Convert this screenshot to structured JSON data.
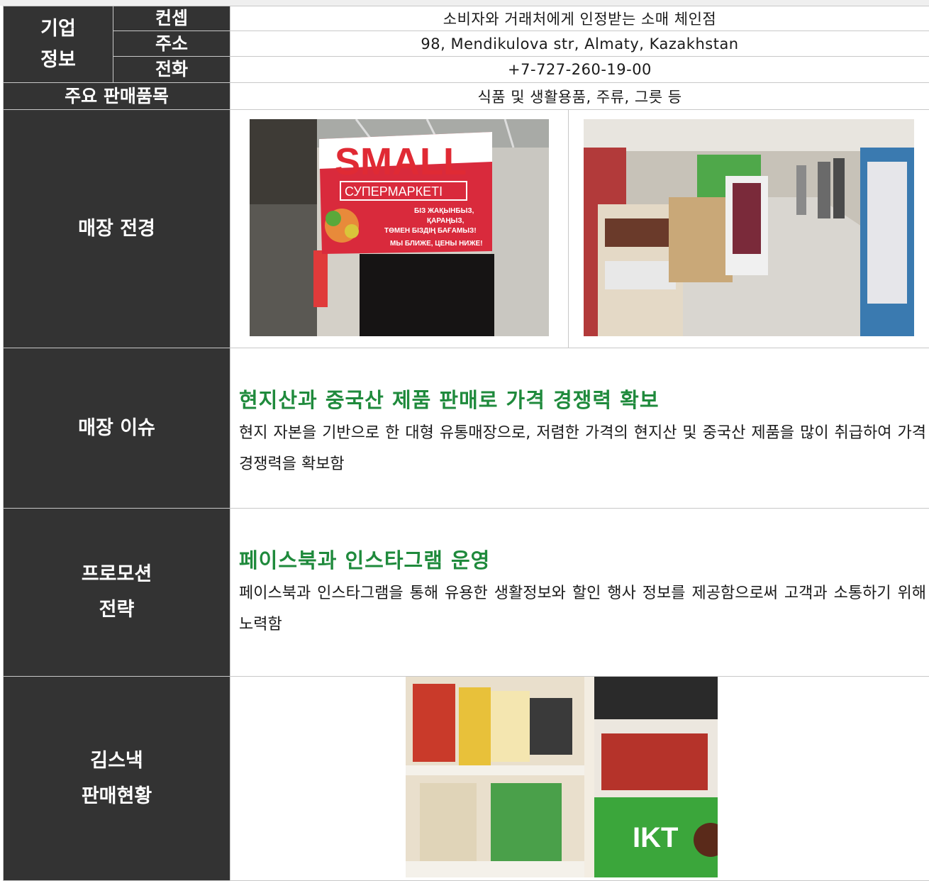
{
  "company_info": {
    "group_label_line1": "기업",
    "group_label_line2": "정보",
    "concept_label": "컨셉",
    "concept_value": "소비자와 거래처에게 인정받는 소매 체인점",
    "address_label": "주소",
    "address_value": "98, Mendikulova str, Almaty, Kazakhstan",
    "phone_label": "전화",
    "phone_value": "+7-727-260-19-00"
  },
  "main_items": {
    "label": "주요 판매품목",
    "value": "식품 및 생활용품, 주류, 그릇 등"
  },
  "store_view": {
    "label": "매장 전경",
    "sign": {
      "brand": "SMALL",
      "subtitle": "СУПЕРМАРКЕТІ",
      "line1": "БІЗ ЖАҚЫНБЫЗ,",
      "line2": "ҚАРАҢЫЗ,",
      "line3": "ТӨМЕН БІЗДІҢ БАҒАМЫЗ!",
      "line4": "МЫ БЛИЖЕ, ЦЕНЫ НИЖЕ!"
    }
  },
  "store_issue": {
    "label": "매장 이슈",
    "title": "현지산과 중국산 제품 판매로 가격 경쟁력 확보",
    "body": "현지 자본을 기반으로 한 대형 유통매장으로, 저렴한 가격의 현지산 및 중국산 제품을 많이 취급하여 가격 경쟁력을 확보함"
  },
  "promotion": {
    "label_line1": "프로모션",
    "label_line2": "전략",
    "title": "페이스북과 인스타그램 운영",
    "body": "페이스북과 인스타그램을 통해 유용한 생활정보와 할인 행사 정보를 제공함으로써 고객과 소통하기 위해 노력함"
  },
  "snack_status": {
    "label_line1": "김스낵",
    "label_line2": "판매현황",
    "shelf_sign": "IKT"
  },
  "colors": {
    "header_bg": "#333333",
    "accent_green": "#1f8a3c",
    "border": "#c8c8c8"
  }
}
